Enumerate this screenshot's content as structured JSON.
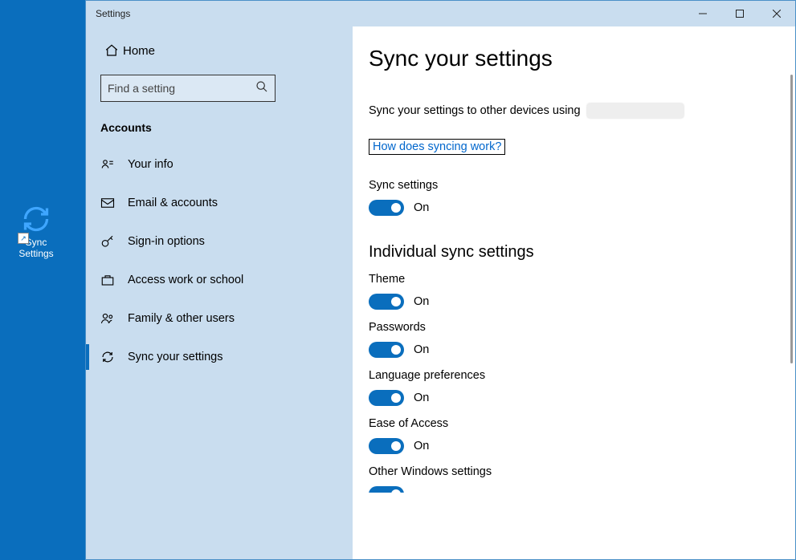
{
  "desktop": {
    "icon_label": "Sync Settings"
  },
  "titlebar": {
    "title": "Settings"
  },
  "sidebar": {
    "home": "Home",
    "search_placeholder": "Find a setting",
    "section": "Accounts",
    "items": [
      {
        "label": "Your info"
      },
      {
        "label": "Email & accounts"
      },
      {
        "label": "Sign-in options"
      },
      {
        "label": "Access work or school"
      },
      {
        "label": "Family & other users"
      },
      {
        "label": "Sync your settings"
      }
    ]
  },
  "main": {
    "heading": "Sync your settings",
    "desc": "Sync your settings to other devices using",
    "link": "How does syncing work?",
    "master_toggle": {
      "label": "Sync settings",
      "state": "On"
    },
    "sub_heading": "Individual sync settings",
    "toggles": [
      {
        "label": "Theme",
        "state": "On"
      },
      {
        "label": "Passwords",
        "state": "On"
      },
      {
        "label": "Language preferences",
        "state": "On"
      },
      {
        "label": "Ease of Access",
        "state": "On"
      },
      {
        "label": "Other Windows settings",
        "state": ""
      }
    ]
  }
}
